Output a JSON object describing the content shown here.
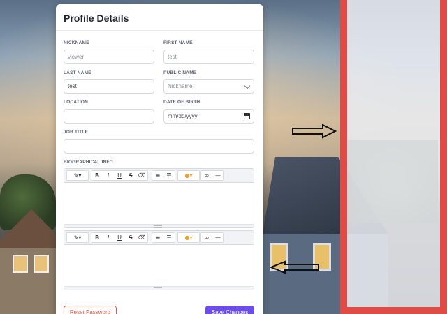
{
  "profile": {
    "title": "Profile Details",
    "fields": {
      "nickname": {
        "label": "NICKNAME",
        "value": "viewer"
      },
      "first_name": {
        "label": "FIRST NAME",
        "value": "test"
      },
      "last_name": {
        "label": "LAST NAME",
        "value": "test"
      },
      "public_name": {
        "label": "PUBLIC NAME",
        "value": "Nickname"
      },
      "location": {
        "label": "LOCATION",
        "value": ""
      },
      "date_of_birth": {
        "label": "DATE OF BIRTH",
        "value": "mm/dd/yyyy"
      },
      "job_title": {
        "label": "JOB TITLE",
        "value": ""
      },
      "bio": {
        "label": "BIOGRAPHICAL INFO"
      }
    },
    "toolbar": {
      "magic": "✎▾",
      "bold": "B",
      "italic": "I",
      "underline": "U",
      "strikethrough": "S",
      "eraser": "⌫",
      "bullet_list": "≡",
      "numbered_list": "☰",
      "color": "●▾",
      "link": "∞",
      "hr": "—"
    },
    "buttons": {
      "reset_password": "Reset Password",
      "save_changes": "Save Changes"
    }
  },
  "colors": {
    "accent": "#6c4de6",
    "danger": "#e2574c",
    "annotation_red": "#e04b45"
  }
}
